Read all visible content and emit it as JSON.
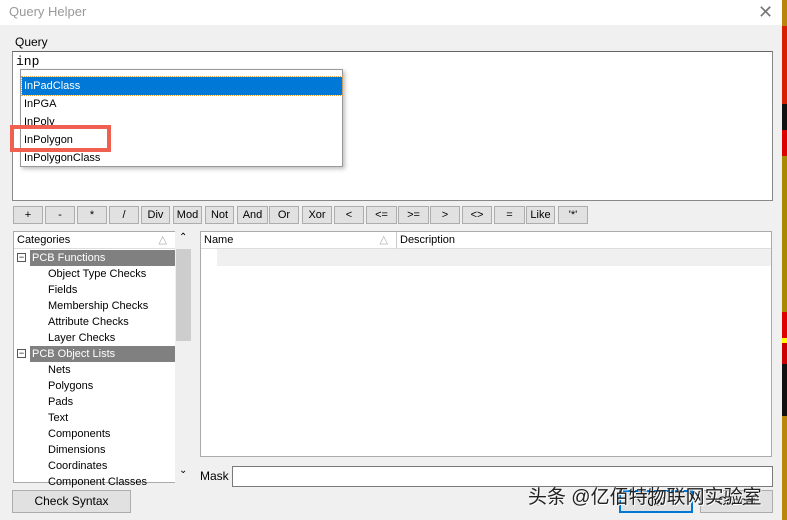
{
  "window": {
    "title": "Query Helper",
    "close_icon": "close-icon"
  },
  "query": {
    "label": "Query",
    "value": "inp"
  },
  "autocomplete": {
    "items": [
      "InPadClass",
      "InPGA",
      "InPoly",
      "InPolygon",
      "InPolygonClass"
    ],
    "selected": "InPadClass",
    "highlighted": "InPolygon",
    "highlight_color": "#f06050",
    "selection_color": "#0078d7"
  },
  "operators": [
    "+",
    "-",
    "*",
    "/",
    "Div",
    "Mod",
    "Not",
    "And",
    "Or",
    "Xor",
    "<",
    "<=",
    ">=",
    ">",
    "<>",
    "=",
    "Like",
    "'*'"
  ],
  "categories": {
    "header": "Categories",
    "groups": [
      {
        "label": "PCB Functions",
        "items": [
          "Object Type Checks",
          "Fields",
          "Membership Checks",
          "Attribute Checks",
          "Layer Checks"
        ]
      },
      {
        "label": "PCB Object Lists",
        "items": [
          "Nets",
          "Polygons",
          "Pads",
          "Text",
          "Components",
          "Dimensions",
          "Coordinates",
          "Component Classes"
        ]
      }
    ]
  },
  "list": {
    "columns": [
      "Name",
      "Description"
    ]
  },
  "mask": {
    "label": "Mask",
    "value": ""
  },
  "buttons": {
    "check_syntax": "Check Syntax",
    "ok": "OK",
    "cancel": "Cancel"
  },
  "watermark": "头条 @亿佰特物联网实验室"
}
